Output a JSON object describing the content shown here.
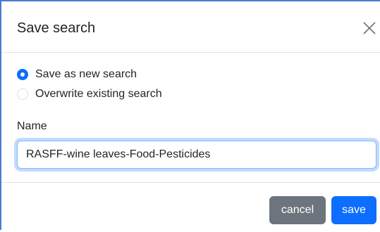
{
  "dialog": {
    "title": "Save search",
    "close_icon": "close-icon"
  },
  "options": {
    "save_as_new": {
      "label": "Save as new search",
      "checked": true
    },
    "overwrite": {
      "label": "Overwrite existing search",
      "checked": false
    }
  },
  "name_field": {
    "label": "Name",
    "value": "RASFF-wine leaves-Food-Pesticides"
  },
  "footer": {
    "cancel_label": "cancel",
    "save_label": "save"
  },
  "colors": {
    "primary": "#0d6efd",
    "secondary": "#6c757d",
    "focus_border": "#86b7fe",
    "divider": "#dee2e6"
  }
}
